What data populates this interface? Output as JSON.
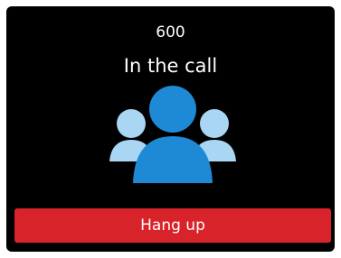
{
  "call": {
    "number": "600",
    "status": "In the call"
  },
  "icon": {
    "name": "conference-group-icon",
    "primary_color": "#1e8ad6",
    "secondary_color": "#a9d6f2"
  },
  "actions": {
    "hangup_label": "Hang up",
    "hangup_color": "#d9232a"
  }
}
